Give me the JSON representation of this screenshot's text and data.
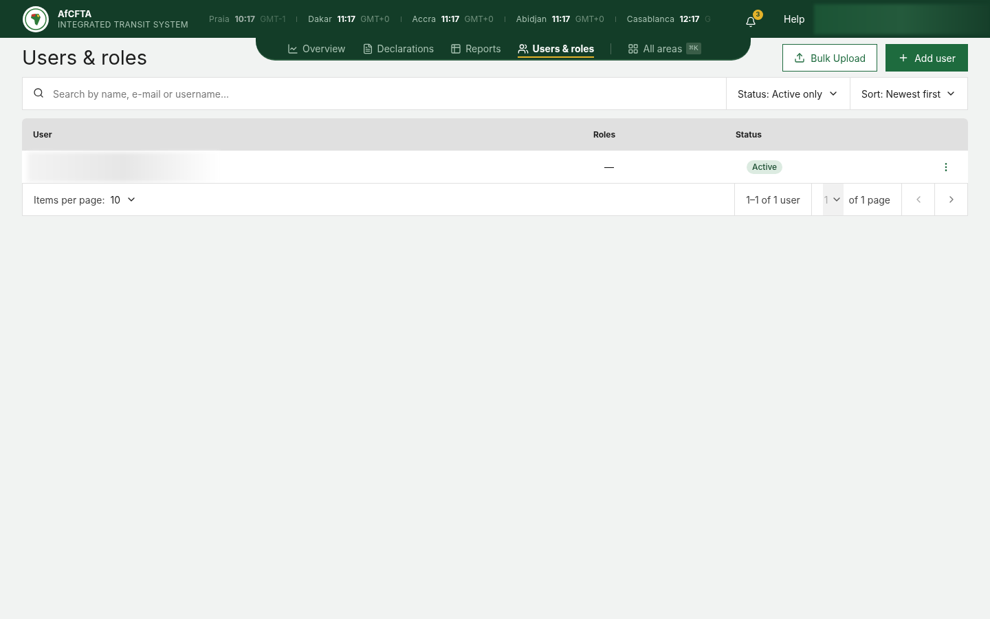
{
  "brand": {
    "name": "AfCFTA",
    "subtitle": "INTEGRATED TRANSIT SYSTEM"
  },
  "clocks": [
    {
      "city": "Praia",
      "time": "10:17",
      "zone": "GMT-1"
    },
    {
      "city": "Dakar",
      "time": "11:17",
      "zone": "GMT+0"
    },
    {
      "city": "Accra",
      "time": "11:17",
      "zone": "GMT+0"
    },
    {
      "city": "Abidjan",
      "time": "11:17",
      "zone": "GMT+0"
    },
    {
      "city": "Casablanca",
      "time": "12:17",
      "zone": "G"
    }
  ],
  "notifications": {
    "count": "3"
  },
  "help": "Help",
  "nav": [
    {
      "kind": "overview",
      "label": "Overview",
      "selected": false
    },
    {
      "kind": "declarations",
      "label": "Declarations",
      "selected": false
    },
    {
      "kind": "reports",
      "label": "Reports",
      "selected": false
    },
    {
      "kind": "users",
      "label": "Users & roles",
      "selected": true
    }
  ],
  "all_areas": {
    "label": "All areas",
    "shortcut": "⌘K"
  },
  "page_title": "Users & roles",
  "actions": {
    "bulk_upload": "Bulk Upload",
    "add_user": "Add user"
  },
  "search": {
    "placeholder": "Search by name, e-mail or username..."
  },
  "filters": {
    "status": "Status: Active only",
    "sort": "Sort: Newest first"
  },
  "table": {
    "columns": [
      "User",
      "Roles",
      "Status"
    ],
    "rows": [
      {
        "roles": "—",
        "status": "Active"
      }
    ]
  },
  "pagination": {
    "items_label": "Items per page:",
    "items_value": "10",
    "range": "1–1 of 1 user",
    "page": "1",
    "of_pages": "of 1 page"
  }
}
